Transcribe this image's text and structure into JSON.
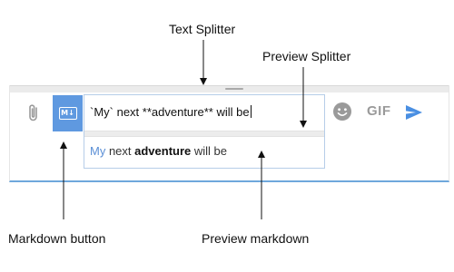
{
  "callouts": {
    "text_splitter": "Text Splitter",
    "preview_splitter": "Preview Splitter",
    "markdown_button": "Markdown button",
    "preview_markdown": "Preview markdown"
  },
  "composer": {
    "markdown_button_label": "M↓",
    "input_value": "`My` next **adventure** will be",
    "preview": {
      "code": "My",
      "text1": " next ",
      "bold": "adventure",
      "text2": " will be"
    },
    "gif_label": "GIF"
  },
  "colors": {
    "accent": "#5f99e0",
    "send": "#4a8fe2",
    "muted_icon": "#9a9a9a",
    "focus_border": "#6fa8dc"
  },
  "icons": [
    "paperclip-icon",
    "markdown-icon",
    "emoji-icon",
    "send-icon"
  ]
}
